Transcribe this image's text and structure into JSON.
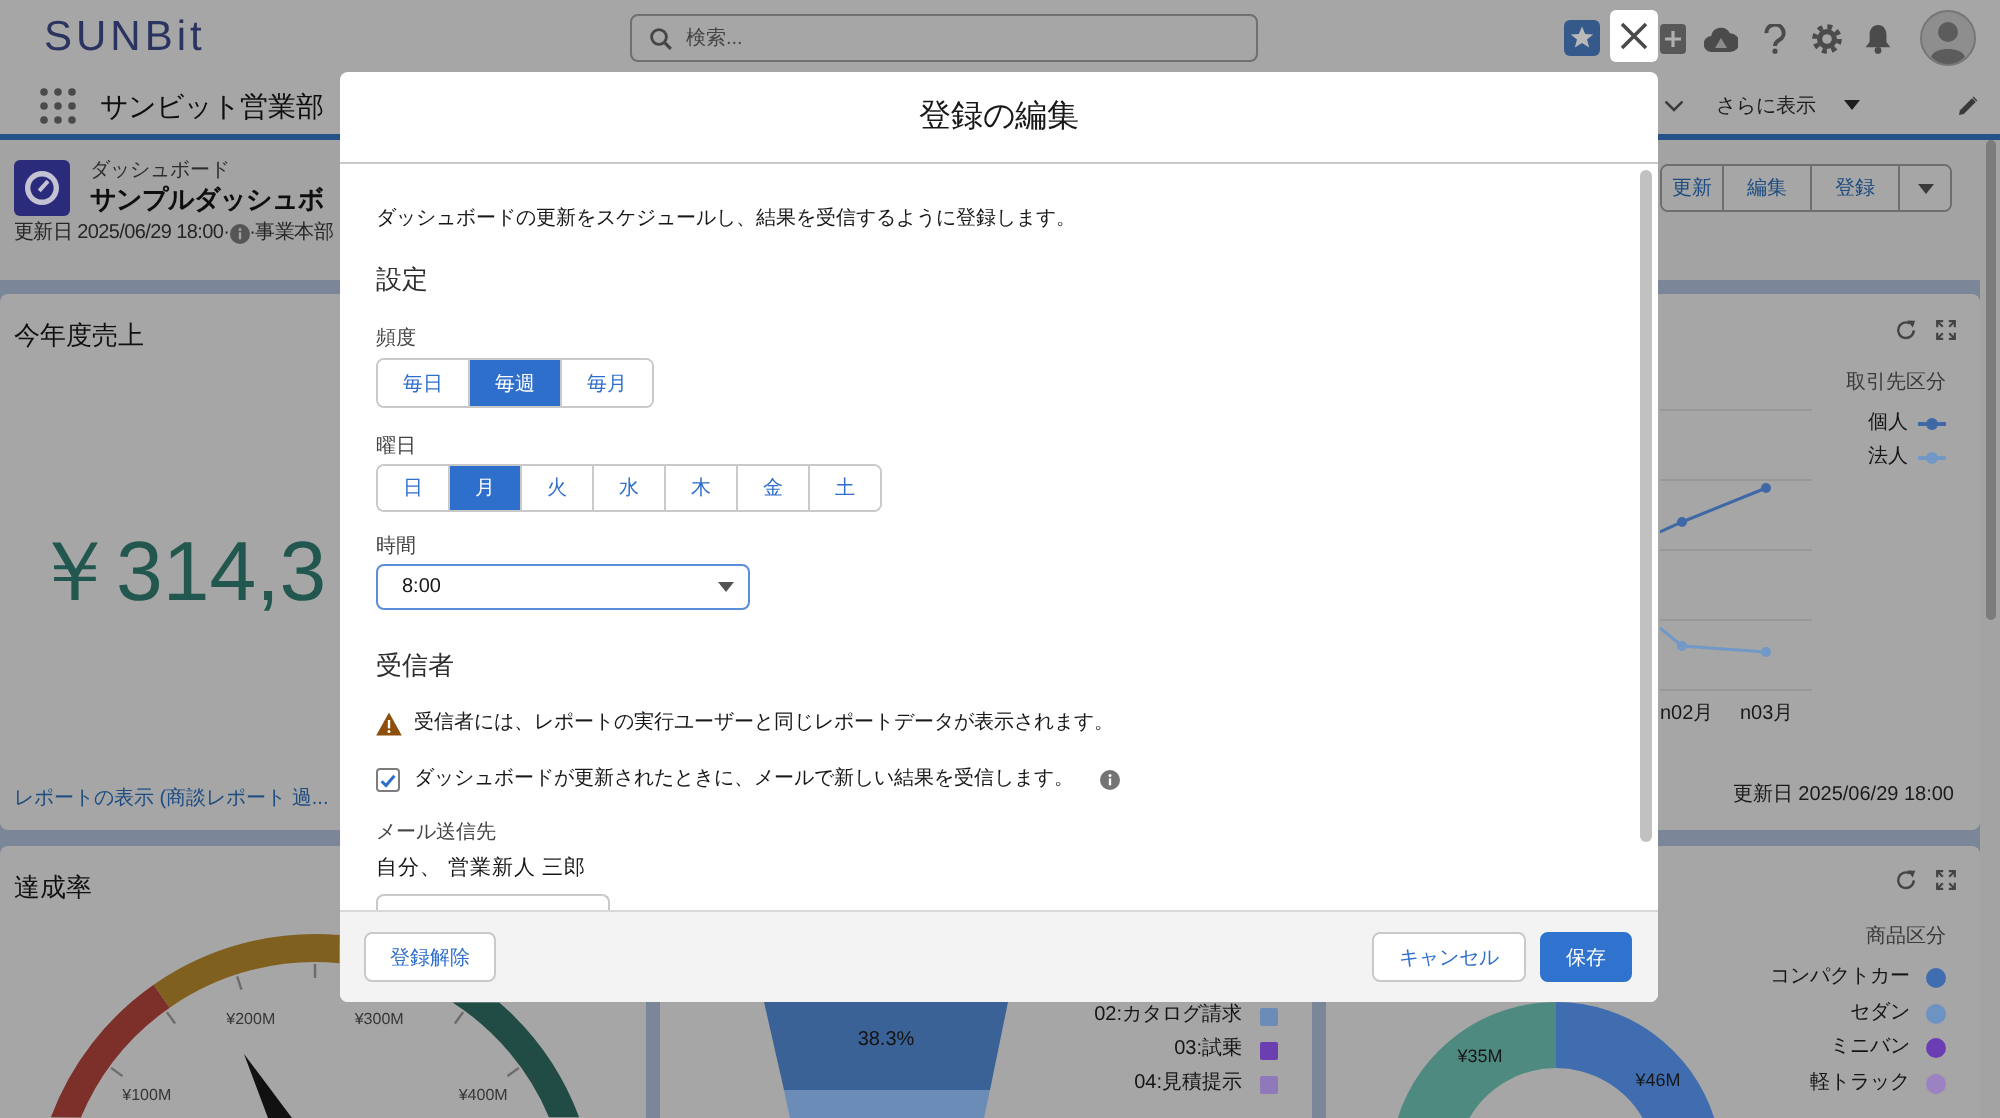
{
  "header": {
    "logo": "SUNBit",
    "search": {
      "placeholder": "検索..."
    }
  },
  "nav": {
    "app_name": "サンビット営業部",
    "more": "さらに表示"
  },
  "dashboard": {
    "type_label": "ダッシュボード",
    "title": "サンプルダッシュボ",
    "updated": "更新日 2025/06/29 18:00·",
    "owner": "·事業本部",
    "actions": [
      "更新",
      "編集",
      "登録"
    ]
  },
  "sales_card": {
    "title": "今年度売上",
    "value": "￥314,3",
    "link": "レポートの表示 (商談レポート 過..."
  },
  "achievement_card": {
    "title": "達成率",
    "tick_labels": [
      "¥100M",
      "¥200M",
      "¥300M",
      "¥400M"
    ]
  },
  "funnel_card": {
    "segment_label": "38.3%",
    "legend": [
      {
        "label": "02:カタログ請求",
        "color": "#6b8cb6"
      },
      {
        "label": "03:試乗",
        "color": "#6b3fb0"
      },
      {
        "label": "04:見積提示",
        "color": "#8f79bb"
      }
    ]
  },
  "customer_card": {
    "legend_title": "取引先区分",
    "legend": [
      {
        "label": "個人",
        "color": "#3f68a6"
      },
      {
        "label": "法人",
        "color": "#7198c6"
      }
    ],
    "x_labels": [
      "n02月",
      "n03月"
    ],
    "updated": "更新日 2025/06/29 18:00"
  },
  "product_card": {
    "legend_title": "商品区分",
    "legend": [
      {
        "label": "コンパクトカー",
        "color": "#3f6db0"
      },
      {
        "label": "セダン",
        "color": "#6d93c3"
      },
      {
        "label": "ミニバン",
        "color": "#6b3db3"
      },
      {
        "label": "軽トラック",
        "color": "#9b82c2"
      }
    ],
    "slice_labels": [
      "¥35M",
      "¥46M"
    ]
  },
  "modal": {
    "title": "登録の編集",
    "description": "ダッシュボードの更新をスケジュールし、結果を受信するように登録します。",
    "settings_heading": "設定",
    "frequency": {
      "label": "頻度",
      "options": [
        {
          "label": "毎日",
          "selected": false
        },
        {
          "label": "毎週",
          "selected": true
        },
        {
          "label": "毎月",
          "selected": false
        }
      ]
    },
    "weekday": {
      "label": "曜日",
      "options": [
        {
          "label": "日",
          "selected": false
        },
        {
          "label": "月",
          "selected": true
        },
        {
          "label": "火",
          "selected": false
        },
        {
          "label": "水",
          "selected": false
        },
        {
          "label": "木",
          "selected": false
        },
        {
          "label": "金",
          "selected": false
        },
        {
          "label": "土",
          "selected": false
        }
      ]
    },
    "time": {
      "label": "時間",
      "value": "8:00"
    },
    "recipients_heading": "受信者",
    "warning": "受信者には、レポートの実行ユーザーと同じレポートデータが表示されます。",
    "email_option": {
      "label": "ダッシュボードが更新されたときに、メールで新しい結果を受信します。",
      "checked": true
    },
    "send_to": {
      "label": "メール送信先",
      "value": "自分、 営業新人 三郎"
    },
    "buttons": {
      "unsubscribe": "登録解除",
      "cancel": "キャンセル",
      "save": "保存"
    }
  }
}
